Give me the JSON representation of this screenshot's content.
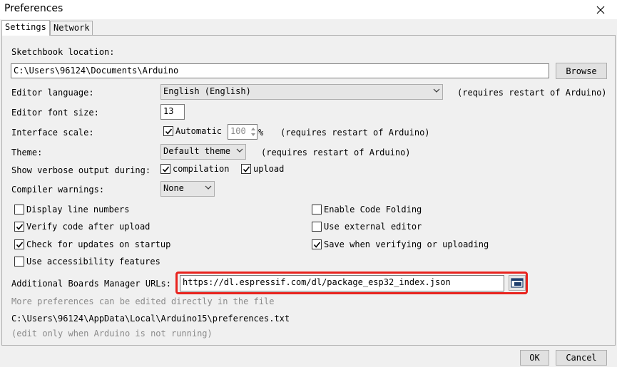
{
  "window": {
    "title": "Preferences"
  },
  "tabs": [
    {
      "label": "Settings"
    },
    {
      "label": "Network"
    }
  ],
  "sketchbook": {
    "label": "Sketchbook location:",
    "value": "C:\\Users\\96124\\Documents\\Arduino",
    "browse_label": "Browse"
  },
  "editor_language": {
    "label": "Editor language:",
    "value": "English (English)",
    "note": "(requires restart of Arduino)"
  },
  "editor_font_size": {
    "label": "Editor font size:",
    "value": "13"
  },
  "interface_scale": {
    "label": "Interface scale:",
    "automatic_label": "Automatic",
    "value": "100",
    "unit": "%",
    "note": "(requires restart of Arduino)"
  },
  "theme": {
    "label": "Theme:",
    "value": "Default theme",
    "note": "(requires restart of Arduino)"
  },
  "verbose": {
    "label": "Show verbose output during:",
    "compilation_label": "compilation",
    "upload_label": "upload"
  },
  "compiler_warnings": {
    "label": "Compiler warnings:",
    "value": "None"
  },
  "options": {
    "display_line_numbers": "Display line numbers",
    "verify_code": "Verify code after upload",
    "check_updates": "Check for updates on startup",
    "accessibility": "Use accessibility features",
    "code_folding": "Enable Code Folding",
    "external_editor": "Use external editor",
    "save_verifying": "Save when verifying or uploading"
  },
  "boards_urls": {
    "label": "Additional Boards Manager URLs:",
    "value": "https://dl.espressif.com/dl/package_esp32_index.json"
  },
  "more_prefs": {
    "note": "More preferences can be edited directly in the file",
    "path": "C:\\Users\\96124\\AppData\\Local\\Arduino15\\preferences.txt",
    "edit_note": "(edit only when Arduino is not running)"
  },
  "footer": {
    "ok_label": "OK",
    "cancel_label": "Cancel"
  },
  "colors": {
    "highlight": "#e8231e",
    "check": "#000000"
  }
}
